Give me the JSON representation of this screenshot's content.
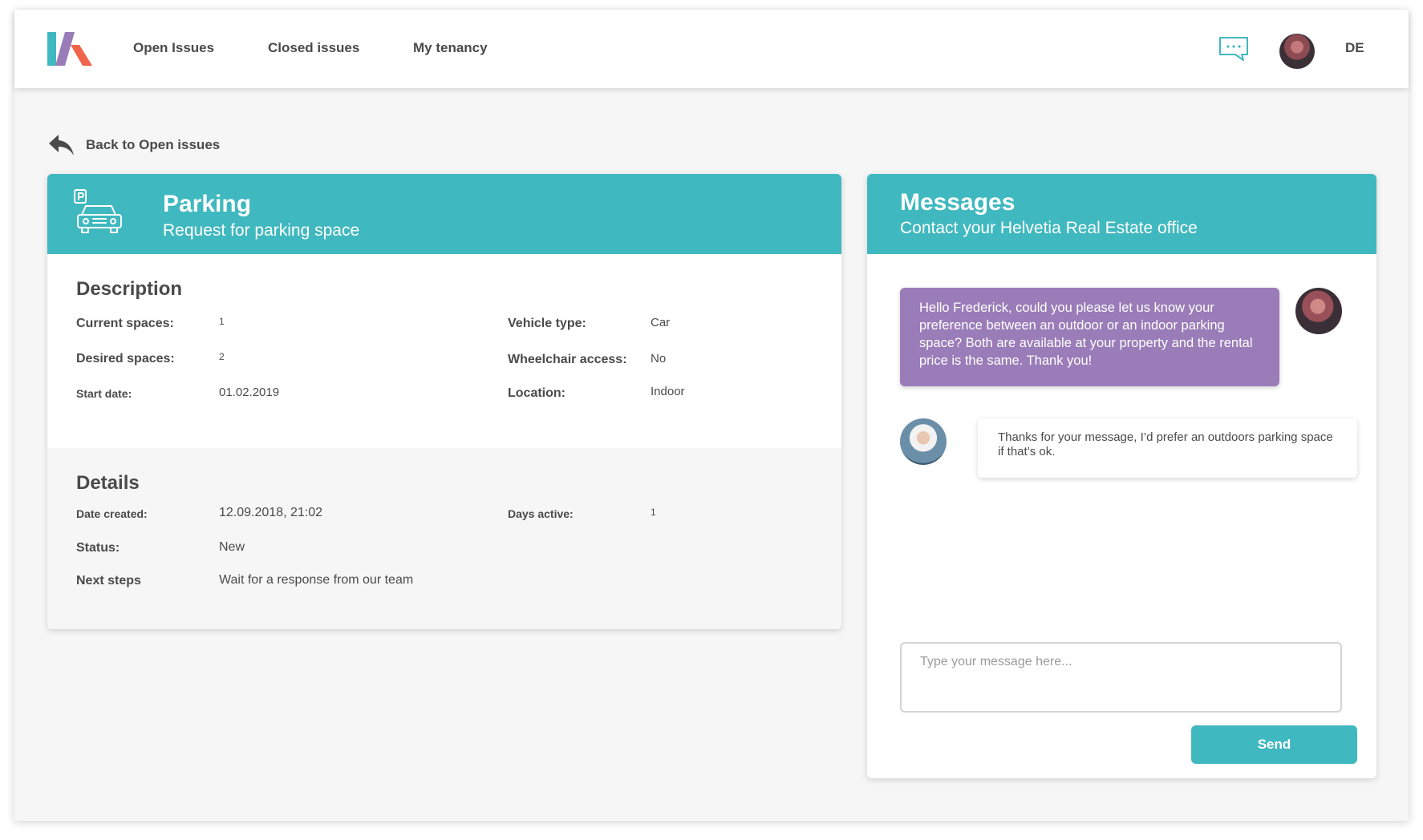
{
  "nav": {
    "links": [
      "Open Issues",
      "Closed issues",
      "My tenancy"
    ],
    "language": "DE"
  },
  "back": {
    "label": "Back to Open issues"
  },
  "issue": {
    "title": "Parking",
    "subtitle": "Request for parking space",
    "description": {
      "heading": "Description",
      "current_spaces_label": "Current spaces:",
      "current_spaces": "1",
      "desired_spaces_label": "Desired spaces:",
      "desired_spaces": "2",
      "start_date_label": "Start date:",
      "start_date": "01.02.2019",
      "vehicle_type_label": "Vehicle type:",
      "vehicle_type": "Car",
      "wheelchair_label": "Wheelchair access:",
      "wheelchair": "No",
      "location_label": "Location:",
      "location": "Indoor"
    },
    "details": {
      "heading": "Details",
      "date_created_label": "Date created:",
      "date_created": "12.09.2018, 21:02",
      "days_active_label": "Days active:",
      "days_active": "1",
      "status_label": "Status:",
      "status": "New",
      "next_steps_label": "Next steps",
      "next_steps": "Wait for a response from our team"
    }
  },
  "messages": {
    "title": "Messages",
    "subtitle": "Contact your Helvetia Real Estate office",
    "thread": [
      {
        "from": "office",
        "text": "Hello Frederick, could you please let us know your preference between an outdoor or an indoor parking space? Both are available at your property and the rental price is the same. Thank you!"
      },
      {
        "from": "tenant",
        "text": "Thanks for your message, I’d prefer an outdoors parking space if that’s ok."
      }
    ],
    "input_placeholder": "Type your message here...",
    "send_label": "Send"
  },
  "colors": {
    "accent": "#40b8bf",
    "office_bubble": "#9a7cb8",
    "background": "#f6f6f6",
    "text": "#4a4a4a"
  },
  "icons": [
    "logo-icon",
    "chat-icon",
    "avatar",
    "back-arrow-icon",
    "parking-car-icon"
  ]
}
